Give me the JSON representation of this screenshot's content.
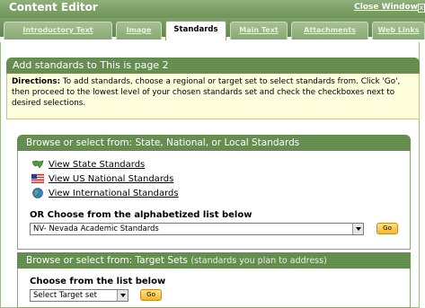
{
  "window": {
    "title": "Content Editor",
    "close_label": "Close Window",
    "close_glyph": "x"
  },
  "tabs": [
    {
      "label": "Introductory Text",
      "active": false
    },
    {
      "label": "Image",
      "active": false
    },
    {
      "label": "Standards",
      "active": true
    },
    {
      "label": "Main Text",
      "active": false
    },
    {
      "label": "Attachments",
      "active": false
    },
    {
      "label": "Web Links",
      "active": false
    }
  ],
  "section": {
    "title": "Add standards to This is page 2"
  },
  "directions": {
    "label": "Directions:",
    "text": " To add standards, choose a regional or target set to select standards from. Click 'Go', then proceed to the lowest level of your chosen standards set and check the checkboxes next to desired selections."
  },
  "browse_standards": {
    "header": "Browse or select from: State, National, or Local Standards",
    "links": [
      {
        "label": "View State Standards",
        "icon": "state-map-icon"
      },
      {
        "label": "View US National Standards",
        "icon": "us-flag-icon"
      },
      {
        "label": "View International Standards",
        "icon": "globe-icon"
      }
    ],
    "or_label": "OR Choose from the alphabetized list below",
    "selected_value": "NV- Nevada Academic Standards",
    "go_label": "Go"
  },
  "target_sets": {
    "header": "Browse or select from: Target Sets",
    "header_sub": "(standards you plan to address)",
    "choose_label": "Choose from the list below",
    "selected_value": "Select Target set",
    "go_label": "Go"
  },
  "colors": {
    "accent_green": "#6e9658",
    "directions_bg": "#fefedc",
    "go_button": "#f2b730"
  }
}
